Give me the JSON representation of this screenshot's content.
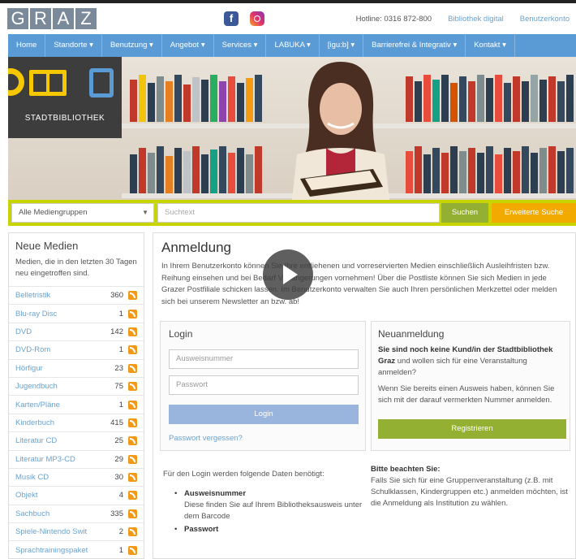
{
  "header": {
    "logo_letters": [
      "G",
      "R",
      "A",
      "Z"
    ],
    "hotline": "Hotline: 0316 872-800",
    "link_digital": "Bibliothek digital",
    "link_konto": "Benutzerkonto",
    "social": [
      "facebook-icon",
      "instagram-icon"
    ]
  },
  "nav": {
    "items": [
      "Home",
      "Standorte ▾",
      "Benutzung ▾",
      "Angebot ▾",
      "Services ▾",
      "LABUKA ▾",
      "[igu:b] ▾",
      "Barrierefrei & Integrativ ▾",
      "Kontakt ▾"
    ]
  },
  "hero": {
    "label": "STADTBIBLIOTHEK"
  },
  "search": {
    "category": "Alle Mediengruppen",
    "placeholder": "Suchtext",
    "search_label": "Suchen",
    "advanced_label": "Erweiterte Suche"
  },
  "sidebar": {
    "title": "Neue Medien",
    "desc": "Medien, die in den letzten 30 Tagen neu eingetroffen sind.",
    "items": [
      {
        "name": "Belletristik",
        "count": "360"
      },
      {
        "name": "Blu-ray Disc",
        "count": "1"
      },
      {
        "name": "DVD",
        "count": "142"
      },
      {
        "name": "DVD-Rom",
        "count": "1"
      },
      {
        "name": "Hörfigur",
        "count": "23"
      },
      {
        "name": "Jugendbuch",
        "count": "75"
      },
      {
        "name": "Karten/Pläne",
        "count": "1"
      },
      {
        "name": "Kinderbuch",
        "count": "415"
      },
      {
        "name": "Literatur CD",
        "count": "25"
      },
      {
        "name": "Literatur MP3-CD",
        "count": "29"
      },
      {
        "name": "Musik CD",
        "count": "30"
      },
      {
        "name": "Objekt",
        "count": "4"
      },
      {
        "name": "Sachbuch",
        "count": "335"
      },
      {
        "name": "Spiele-Nintendo Swit",
        "count": "2"
      },
      {
        "name": "Sprachtrainingspaket",
        "count": "1"
      }
    ]
  },
  "main": {
    "title": "Anmeldung",
    "intro": "In Ihrem Benutzerkonto können Sie Ihre entliehenen und vorreservierten Medien einschließlich Ausleihfristen bzw. Reihung einsehen und bei Bedarf Verlängerungen vornehmen! Über die Postliste können Sie sich Medien in jede Grazer Postfiliale schicken lassen. Im Benutzerkonto verwalten Sie auch Ihren persönlichen Merkzettel oder melden sich bei unserem Newsletter an bzw. ab!",
    "login": {
      "title": "Login",
      "user_placeholder": "Ausweisnummer",
      "pass_placeholder": "Passwort",
      "button": "Login",
      "forgot": "Passwort vergessen?"
    },
    "register": {
      "title": "Neuanmeldung",
      "q_bold": "Sie sind noch keine Kund/in der Stadtbibliothek Graz",
      "q_rest": " und wollen sich für eine Veranstaltung anmelden?",
      "p2": "Wenn Sie bereits einen Ausweis haben, können Sie sich mit der darauf vermerkten Nummer anmelden.",
      "button": "Registrieren"
    },
    "logindata": {
      "intro": "Für den Login werden folgende Daten benötigt:",
      "item1_title": "Ausweisnummer",
      "item1_desc": "Diese finden Sie auf Ihrem Bibliotheksausweis unter dem Barcode",
      "item2_title": "Passwort"
    },
    "note": {
      "title": "Bitte beachten Sie:",
      "text": "Falls Sie sich für eine Gruppenveranstaltung (z.B. mit Schulklassen, Kindergruppen etc.) anmelden möchten, ist die Anmeldung als Institution zu wählen."
    }
  }
}
